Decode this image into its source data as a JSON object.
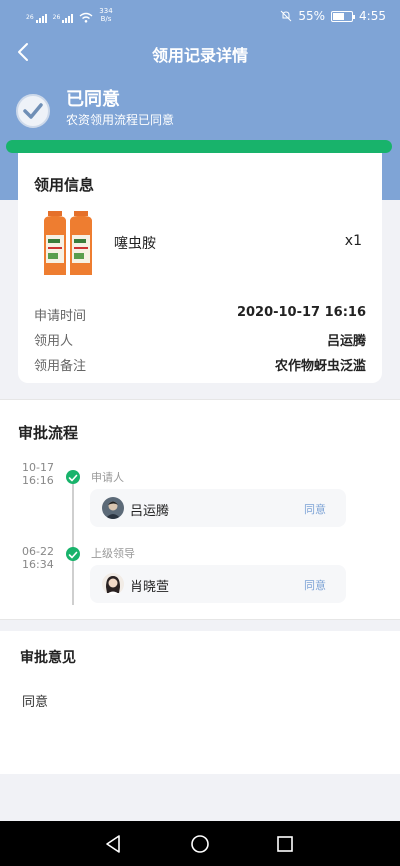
{
  "statusbar": {
    "sim1": "26",
    "sim2": "26",
    "speed_value": "334",
    "speed_unit": "B/s",
    "battery": "55%",
    "time": "4:55"
  },
  "nav": {
    "title": "领用记录详情"
  },
  "status": {
    "title": "已同意",
    "subtitle": "农资领用流程已同意",
    "progress": 1.0
  },
  "info": {
    "title": "领用信息",
    "product": {
      "name": "噻虫胺",
      "qty": "x1"
    },
    "rows": [
      {
        "label": "申请时间",
        "value": "2020-10-17 16:16"
      },
      {
        "label": "领用人",
        "value": "吕运腾"
      },
      {
        "label": "领用备注",
        "value": "农作物蚜虫泛滥"
      }
    ]
  },
  "approval": {
    "title": "审批流程",
    "steps": [
      {
        "date": "10-17",
        "time": "16:16",
        "role": "申请人",
        "name": "吕运腾",
        "result": "同意"
      },
      {
        "date": "06-22",
        "time": "16:34",
        "role": "上级领导",
        "name": "肖晓萱",
        "result": "同意"
      }
    ]
  },
  "opinion": {
    "title": "审批意见",
    "text": "同意"
  },
  "colors": {
    "header": "#7fa4d6",
    "accent_green": "#18b36b",
    "link_blue": "#7fa4d6"
  },
  "icons": [
    "back-arrow-icon",
    "check-circle-icon",
    "timeline-check-icon",
    "nav-back-triangle-icon",
    "nav-home-circle-icon",
    "nav-recent-square-icon"
  ]
}
